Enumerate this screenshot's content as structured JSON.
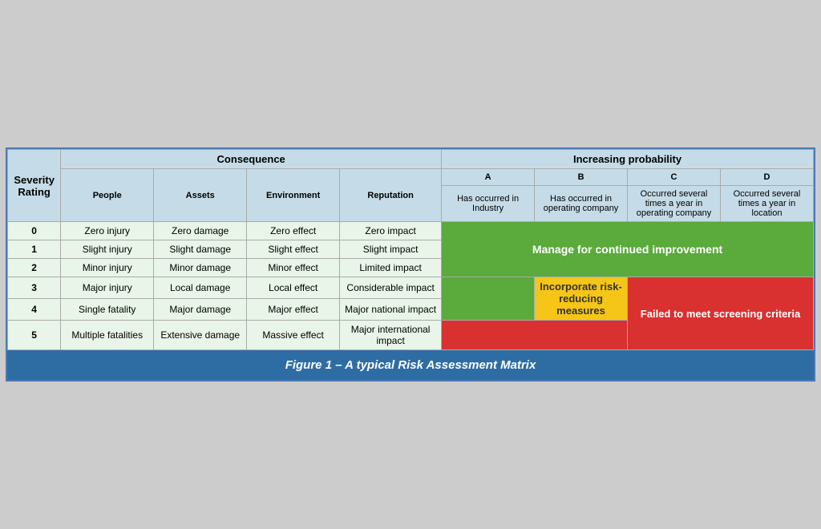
{
  "caption": "Figure 1 – A typical Risk Assessment Matrix",
  "header": {
    "consequence": "Consequence",
    "increasing_probability": "Increasing probability",
    "severity_rating": "Severity Rating",
    "people": "People",
    "assets": "Assets",
    "environment": "Environment",
    "reputation": "Reputation",
    "col_a": "A",
    "col_b": "B",
    "col_c": "C",
    "col_d": "D",
    "col_a_desc": "Has occurred in Industry",
    "col_b_desc": "Has occurred in operating company",
    "col_c_desc": "Occurred several times a year in operating company",
    "col_d_desc": "Occurred several times a year in location"
  },
  "rows": [
    {
      "severity": "0",
      "people": "Zero injury",
      "assets": "Zero damage",
      "environment": "Zero effect",
      "reputation": "Zero impact",
      "zones": [
        "green",
        "green",
        "green",
        "green"
      ]
    },
    {
      "severity": "1",
      "people": "Slight injury",
      "assets": "Slight damage",
      "environment": "Slight effect",
      "reputation": "Slight impact",
      "zones": [
        "green",
        "green",
        "green",
        "yellow"
      ]
    },
    {
      "severity": "2",
      "people": "Minor injury",
      "assets": "Minor damage",
      "environment": "Minor effect",
      "reputation": "Limited impact",
      "zones": [
        "green",
        "green",
        "yellow",
        "red"
      ]
    },
    {
      "severity": "3",
      "people": "Major injury",
      "assets": "Local damage",
      "environment": "Local effect",
      "reputation": "Considerable impact",
      "zones": [
        "green",
        "yellow",
        "red",
        "red"
      ]
    },
    {
      "severity": "4",
      "people": "Single fatality",
      "assets": "Major damage",
      "environment": "Major effect",
      "reputation": "Major national impact",
      "zones": [
        "green",
        "red",
        "red",
        "red"
      ]
    },
    {
      "severity": "5",
      "people": "Multiple fatalities",
      "assets": "Extensive damage",
      "environment": "Massive effect",
      "reputation": "Major international impact",
      "zones": [
        "red",
        "red",
        "red",
        "red"
      ]
    }
  ],
  "zone_labels": {
    "manage": "Manage for continued improvement",
    "incorporate": "Incorporate risk-reducing measures",
    "failed": "Failed to meet screening criteria"
  }
}
